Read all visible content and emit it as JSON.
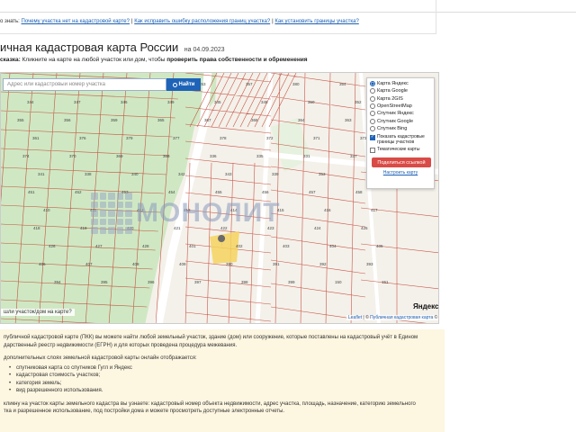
{
  "faq": {
    "label": "о знать:",
    "links": [
      "Почему участка нет на кадастровой карте?",
      "Как исправить ошибку расположения границ участка?",
      "Как установить границы участка?"
    ]
  },
  "header": {
    "title": "ичная кадастровая карта России",
    "date": "на 04.09.2023"
  },
  "hint": {
    "prefix": "сказка:",
    "text": " Кликните на карте на любой участок или дом, чтобы ",
    "bold": "проверить права собственности и обременения"
  },
  "search": {
    "placeholder": "Адрес или кадастровый номер участка",
    "button_label": "Найти"
  },
  "layers": {
    "options": [
      {
        "label": "Карта Яндекс",
        "selected": true
      },
      {
        "label": "Карта Google",
        "selected": false
      },
      {
        "label": "Карта 2GIS",
        "selected": false
      },
      {
        "label": "OpenStreetMap",
        "selected": false
      },
      {
        "label": "Спутник Яндекс",
        "selected": false
      },
      {
        "label": "Спутник Google",
        "selected": false
      },
      {
        "label": "Спутник Bing",
        "selected": false
      }
    ],
    "show_borders_label": "Показать кадастровые границы участков",
    "show_borders_checked": true,
    "thematic_label": "Тематические карты",
    "thematic_checked": false,
    "share_label": "Поделиться ссылкой",
    "setup_label": "Настроить карту"
  },
  "map": {
    "watermark": "МОНОЛИТ",
    "report_link": "шли участок/дом на карте?",
    "yandex_logo": "Яндекс",
    "attribution_leaflet": "Leaflet",
    "attribution_sep": " | © ",
    "attribution_source": "Публичная кадастровая карта",
    "attribution_tail": " ©",
    "parcel_labels": [
      "360",
      "358",
      "382",
      "362",
      "353",
      "357",
      "380",
      "354",
      "344",
      "347",
      "346",
      "349",
      "345",
      "348",
      "350",
      "352",
      "355",
      "356",
      "359",
      "365",
      "367",
      "368",
      "364",
      "363",
      "361",
      "376",
      "379",
      "377",
      "378",
      "372",
      "371",
      "373",
      "374",
      "370",
      "369",
      "366",
      "336",
      "335",
      "331",
      "337",
      "341",
      "338",
      "340",
      "342",
      "343",
      "339",
      "353",
      "451",
      "452",
      "453",
      "454",
      "455",
      "456",
      "457",
      "458",
      "410",
      "411",
      "412",
      "413",
      "414",
      "415",
      "416",
      "417",
      "418",
      "419",
      "420",
      "421",
      "422",
      "423",
      "424",
      "425",
      "426",
      "427",
      "428",
      "401",
      "402",
      "403",
      "404",
      "405",
      "406",
      "407",
      "408",
      "409",
      "390",
      "391",
      "392",
      "393",
      "394",
      "395",
      "396",
      "397",
      "398",
      "399",
      "150",
      "151"
    ]
  },
  "info": {
    "p1": "публичной кадастровой карте (ПКК) вы можете найти любой земельный участок, здание (дом) или сооружение, которые поставлены на кадастровый учёт в Едином",
    "p1b": "дарственный реестр недвижимости (ЕГРН) и для которых проведена процедура межевания.",
    "p2": "дополнительных слоях земельной кадастровой карты онлайн отображается:",
    "items": [
      "спутниковая карта со спутников Гугл и Яндекс",
      "кадастровая стоимость участков;",
      "категория земель;",
      "вид разрешенного использования."
    ],
    "p3": "кликну на участок карты земельного кадастра вы узнаете: кадастровый номер объекта недвижимости, адрес участка, площадь, назначение, категорию земельного",
    "p3b": "тка и разрешенное использование, под постройки дома и можете просмотреть доступные электронные отчеты."
  },
  "colors": {
    "link": "#1a5fb4",
    "search_button": "#1e63b8",
    "share_button": "#d94b46",
    "parcel_line": "#c0392b",
    "green_area": "#cfe8c3",
    "selected_parcel": "#f4d35e",
    "info_bg": "#fdf6e1"
  }
}
